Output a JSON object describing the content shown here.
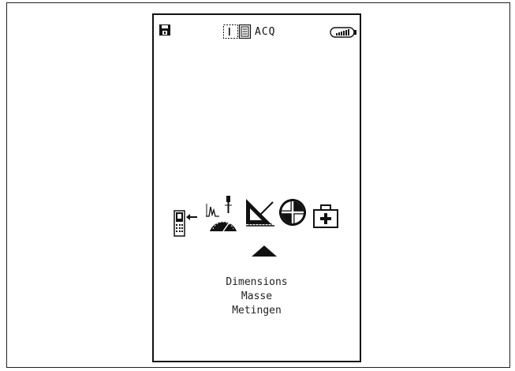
{
  "status_bar": {
    "disk_icon": "floppy-disk-icon",
    "mode_icon": "acquisition-mode-icon",
    "mode_label": "ACQ",
    "battery_icon": "battery-full-icon"
  },
  "menu": {
    "icons": [
      "device-transfer-icon",
      "gauge-vibration-icon",
      "dimensions-ruler-icon",
      "crosshair-alignment-icon",
      "first-aid-kit-icon"
    ],
    "selected_index": 2,
    "selected_labels": [
      "Dimensions",
      "Masse",
      "Metingen"
    ]
  }
}
